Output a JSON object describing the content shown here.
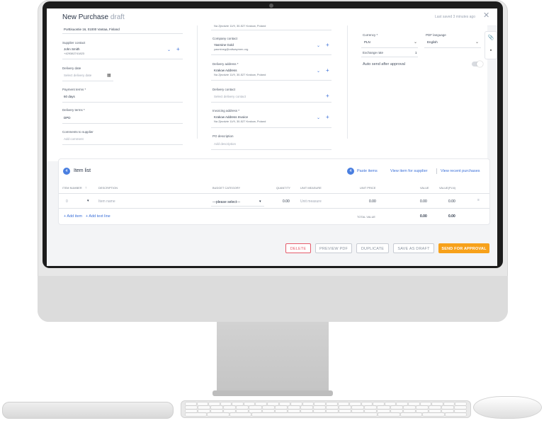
{
  "header": {
    "title": "New Purchase",
    "status": "draft",
    "last_saved": "Last saved 3 minutes ago",
    "close_glyph": "✕"
  },
  "supplier": {
    "address": "Porttisuontie 16, 01000 Vantaa, Finland",
    "contact_label": "Supplier contact",
    "contact_name": "John Smith",
    "contact_phone": "+429382741823",
    "delivery_date_label": "Delivery date",
    "delivery_date_placeholder": "Select delivery date",
    "payment_terms_label": "Payment terms *",
    "payment_terms_value": "60 days",
    "delivery_terms_label": "Delivery terms *",
    "delivery_terms_value": "DPD",
    "comments_label": "Comments to supplier",
    "comments_placeholder": "Add comment"
  },
  "company": {
    "top_address": "Na Zjezdzie 11/9, 30-527 Krakow, Poland",
    "contact_label": "Company contact",
    "contact_name": "Yasmine Gold",
    "contact_email": "yasmineg@railwaymen.org",
    "delivery_address_label": "Delivery address *",
    "delivery_address_name": "Krakow Address",
    "delivery_address_line": "Na Zjezdzie 11/9, 30-527 Krakow, Poland",
    "delivery_contact_label": "Delivery contact",
    "delivery_contact_placeholder": "Select delivery contact",
    "invoicing_address_label": "Invoicing address *",
    "invoicing_address_name": "Krakow Address Invoice",
    "invoicing_address_line": "Na Zjezdzie 11/9, 30-527 Krakow, Poland",
    "po_description_label": "PO description",
    "po_description_placeholder": "Add description"
  },
  "settings": {
    "currency_label": "Currency *",
    "currency_value": "PLN",
    "pdf_language_label": "PDF language",
    "pdf_language_value": "English",
    "exchange_rate_label": "Exchange rate",
    "exchange_rate_value": "1",
    "auto_send_label": "Auto send after approval",
    "auto_send_enabled": false
  },
  "side_tools": {
    "attach_icon": "paperclip-icon",
    "chat_icon": "chat-icon"
  },
  "items": {
    "count": "4",
    "title": "Item list",
    "paste_count": "4",
    "paste_label": "Paste items",
    "view_supplier_label": "View item for supplier",
    "view_recent_label": "View recent purchases",
    "columns": {
      "item_number": "ITEM NUMBER",
      "sort_glyph": "↑",
      "description": "DESCRIPTION",
      "budget_category": "BUDGET CATEGORY",
      "quantity": "QUANTITY",
      "unit_measure": "UNIT MEASURE",
      "unit_price": "UNIT PRICE",
      "value": "VALUE",
      "value_pln": "VALUE(PLN)"
    },
    "row": {
      "item_number": "0",
      "item_name_placeholder": "Item name",
      "budget_category": "---please select---",
      "quantity": "0.00",
      "unit_measure_placeholder": "Unit measure",
      "unit_price": "0.00",
      "value": "0.00",
      "value_pln": "0.00"
    },
    "add_item_label": "+ Add item",
    "add_text_line_label": "+ Add text line",
    "total_label": "TOTAL VALUE",
    "total_value": "0.00",
    "total_value_pln": "0.00"
  },
  "actions": {
    "delete": "DELETE",
    "preview_pdf": "PREVIEW PDF",
    "duplicate": "DUPLICATE",
    "save_as_draft": "SAVE AS DRAFT",
    "send_for_approval": "SEND FOR APPROVAL"
  },
  "colors": {
    "accent": "#3a6fd8",
    "send_button": "#f7a11b",
    "delete_button": "#e55b6b"
  }
}
